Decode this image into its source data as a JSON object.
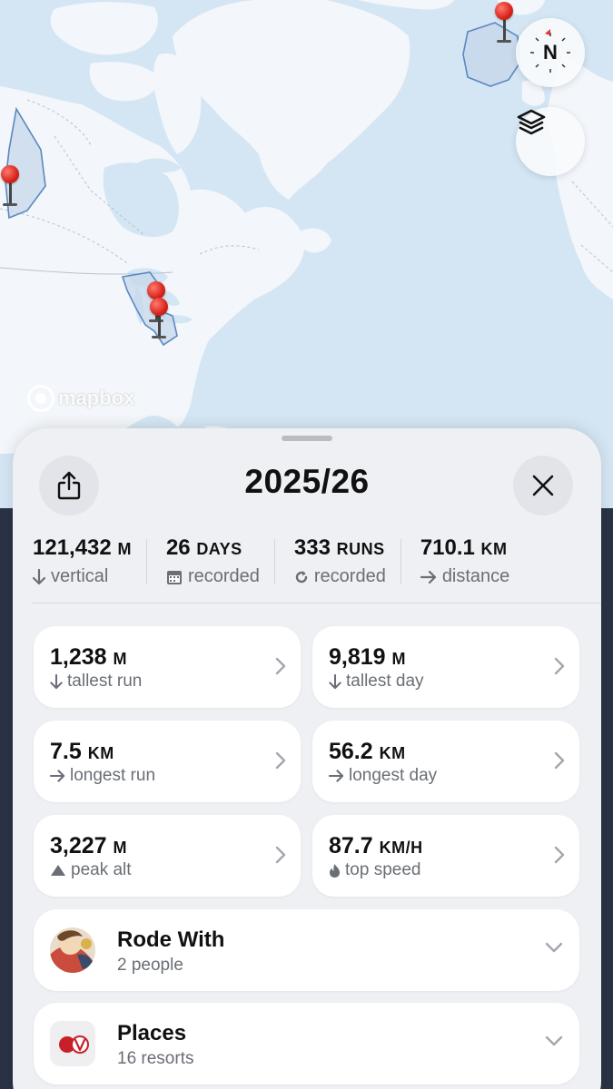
{
  "map": {
    "attribution": "mapbox",
    "compass_label": "N",
    "compass_icon": "compass-icon",
    "layers_icon": "layers-icon",
    "pin_icon": "map-pin-icon",
    "colors": {
      "water": "#d4e6f4",
      "land": "#f3f6fa",
      "region_fill": "#c5d7ea",
      "region_stroke": "#5b88c0"
    }
  },
  "sheet": {
    "title": "2025/26",
    "share_icon": "share-icon",
    "close_icon": "close-icon",
    "summary": [
      {
        "value": "121,432",
        "unit": "M",
        "label": "vertical",
        "icon": "arrow-down-icon"
      },
      {
        "value": "26",
        "unit": "DAYS",
        "label": "recorded",
        "icon": "calendar-icon"
      },
      {
        "value": "333",
        "unit": "RUNS",
        "label": "recorded",
        "icon": "refresh-icon"
      },
      {
        "value": "710.1",
        "unit": "KM",
        "label": "distance",
        "icon": "arrow-right-icon"
      }
    ],
    "stats": [
      {
        "value": "1,238",
        "unit": "M",
        "label": "tallest run",
        "icon": "arrow-down-icon"
      },
      {
        "value": "9,819",
        "unit": "M",
        "label": "tallest day",
        "icon": "arrow-down-icon"
      },
      {
        "value": "7.5",
        "unit": "KM",
        "label": "longest run",
        "icon": "arrow-right-icon"
      },
      {
        "value": "56.2",
        "unit": "KM",
        "label": "longest day",
        "icon": "arrow-right-icon"
      },
      {
        "value": "3,227",
        "unit": "M",
        "label": "peak alt",
        "icon": "mountain-icon"
      },
      {
        "value": "87.7",
        "unit": "KM/H",
        "label": "top speed",
        "icon": "flame-icon"
      }
    ],
    "rows": [
      {
        "title": "Rode With",
        "subtitle": "2 people",
        "icon": "avatar-image"
      },
      {
        "title": "Places",
        "subtitle": "16 resorts",
        "icon": "resort-logo-icon"
      }
    ]
  }
}
